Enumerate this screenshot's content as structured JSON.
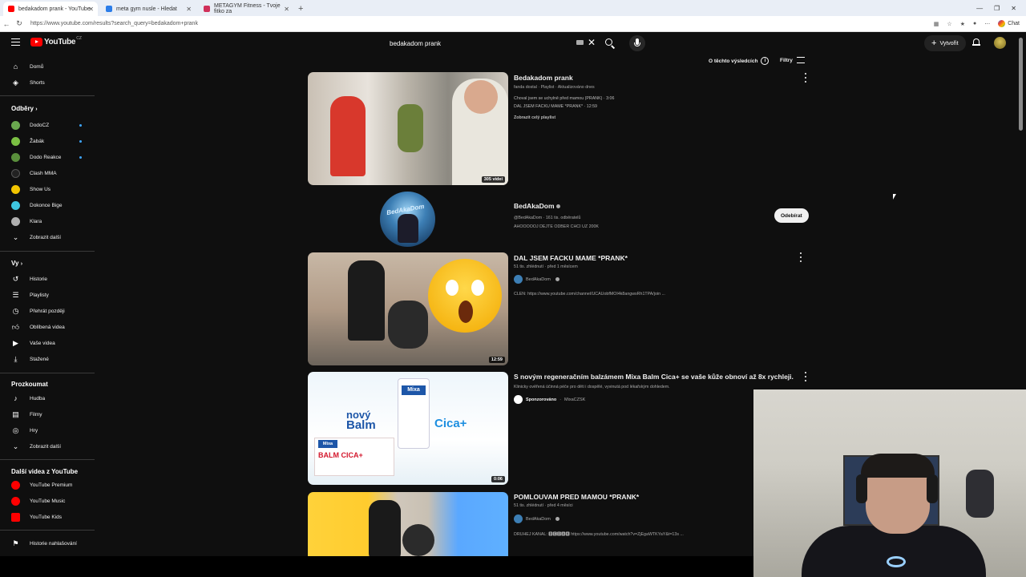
{
  "browser": {
    "tabs": [
      {
        "title": "bedakadom prank - YouTube",
        "fav_color": "#ff0000",
        "active": true
      },
      {
        "title": "meta gym nusle - Hledat",
        "fav_color": "#2b7de9",
        "active": false
      },
      {
        "title": "METAGYM Fitness - Tvoje fitko za",
        "fav_color": "#d0305a",
        "active": false
      }
    ],
    "new_tab": "+",
    "url": "https://www.youtube.com/results?search_query=bedakadom+prank",
    "chat_label": "Chat"
  },
  "masthead": {
    "logo_text": "YouTube",
    "country_code": "CZ",
    "search_value": "bedakadom prank",
    "create_label": "Vytvořit"
  },
  "sidebar": {
    "top_items": [
      {
        "label": "Domů",
        "icon": "home-icon"
      },
      {
        "label": "Shorts",
        "icon": "shorts-icon"
      }
    ],
    "subs_header": "Odběry",
    "subscriptions": [
      {
        "label": "DodoCZ",
        "color": "#6aa84f",
        "live": true
      },
      {
        "label": "Žabák",
        "color": "#7bc043",
        "live": true
      },
      {
        "label": "Dodo Reakce",
        "color": "#5a8f3c",
        "live": true
      },
      {
        "label": "Clash MMA",
        "color": "#222222",
        "live": false
      },
      {
        "label": "Show Us",
        "color": "#f2c500",
        "live": false
      },
      {
        "label": "Dokonce Bige",
        "color": "#3ec6e0",
        "live": false
      },
      {
        "label": "Klara",
        "color": "#b0b0b0",
        "live": false
      }
    ],
    "show_more": "Zobrazit další",
    "you_header": "Vy",
    "you_items": [
      {
        "label": "Historie",
        "icon": "history-icon"
      },
      {
        "label": "Playlisty",
        "icon": "playlist-icon"
      },
      {
        "label": "Přehrát později",
        "icon": "watch-later-icon"
      },
      {
        "label": "Oblíbená videa",
        "icon": "like-icon"
      },
      {
        "label": "Vaše videa",
        "icon": "your-videos-icon"
      },
      {
        "label": "Stažené",
        "icon": "download-icon"
      }
    ],
    "explore_header": "Prozkoumat",
    "explore_items": [
      {
        "label": "Hudba",
        "icon": "music-icon"
      },
      {
        "label": "Filmy",
        "icon": "movies-icon"
      },
      {
        "label": "Hry",
        "icon": "gaming-icon"
      }
    ],
    "explore_more": "Zobrazit další",
    "more_header": "Další videa z YouTube",
    "more_items": [
      {
        "label": "YouTube Premium"
      },
      {
        "label": "YouTube Music"
      },
      {
        "label": "YouTube Kids"
      }
    ],
    "report_history": "Historie nahlašování"
  },
  "results_bar": {
    "about": "O těchto výsledcích",
    "filters": "Filtry"
  },
  "results": {
    "playlist": {
      "title": "Bedakadom prank",
      "meta": "fanda dostal · Playlist · Aktualizováno dnes",
      "line1": "Choval jsem se uchylně před mamou (PRANK) · 3:06",
      "line2": "DAL JSEM FACKU MAME *PRANK* · 12:59",
      "show_full": "Zobrazit celý playlist",
      "count": "305 videí"
    },
    "channel": {
      "name": "BedAkaDom",
      "meta": "@BedAkaDom · 161 tis. odběratelů",
      "desc": "AHOOOOOJ DEJTE ODBER CHCI UZ 200K",
      "subscribe": "Odebírat",
      "avatar_text": "BedAkaDom"
    },
    "video1": {
      "title": "DAL JSEM FACKU MAME *PRANK*",
      "meta": "51 tis. zhlédnutí · před 1 měsícem",
      "channel": "BedAkaDom",
      "desc": "CLEN: https://www.youtube.com/channel/UCAUobfMOI4k8angwsRh1TPA/join ...",
      "duration": "12:59"
    },
    "ad": {
      "title": "S novým regeneračním balzámem Mixa Balm Cica+ se vaše kůže obnoví až 8x rychleji.",
      "meta": "Klinicky ověřená účinná péče pro děti i dospělé, vyvinutá pod lékařským dohledem.",
      "sponsored": "Sponzorováno",
      "advertiser": "MixaCZSK",
      "duration": "0:06",
      "thumb_text_1": "nový",
      "thumb_text_2": "Balm",
      "thumb_text_3": "Cica+",
      "thumb_brand": "Mixa",
      "thumb_pack": "BALM CICA+"
    },
    "video2": {
      "title": "POMLOUVAM PRED MAMOU *PRANK*",
      "meta": "51 tis. zhlédnutí · před 4 měsíci",
      "channel": "BedAkaDom",
      "desc": "DRUHEJ KANAL: 🅱🅴🅳🅰🅺 https://www.youtube.com/watch?v=ZjEgaWTKYaY&t=13s ..."
    }
  }
}
